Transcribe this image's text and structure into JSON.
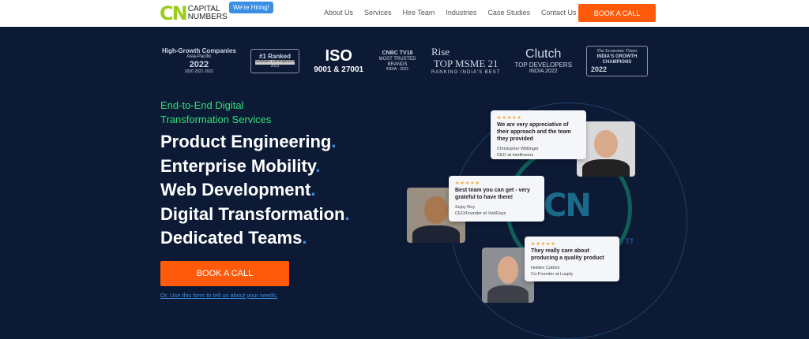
{
  "header": {
    "logo_mark": "CN",
    "logo_line1": "CAPITAL",
    "logo_line2": "NUMBERS",
    "hiring_badge": "We're Hiring!",
    "nav": [
      "About Us",
      "Services",
      "Hire Team",
      "Industries",
      "Case Studies",
      "Contact Us"
    ],
    "book_call": "BOOK A CALL"
  },
  "awards": [
    {
      "l1": "High-Growth Companies",
      "l2": "Asia-Pacific",
      "l3": "2022",
      "l4": "2020 2021 2022"
    },
    {
      "l1": "#1 Ranked",
      "l2": "Software Development",
      "l3": "2022"
    },
    {
      "l1": "ISO",
      "l2": "9001 & 27001"
    },
    {
      "l1": "CNBC TV18",
      "l2": "MOST TRUSTED BRANDS",
      "l3": "INDIA - 2021"
    },
    {
      "l1": "Rise",
      "l2": "TOP MSME 21",
      "l3": "RANKING INDIA'S BEST"
    },
    {
      "l1": "Clutch",
      "l2": "TOP DEVELOPERS",
      "l3": "INDIA 2022"
    },
    {
      "l1": "The Economic Times",
      "l2": "INDIA'S GROWTH CHAMPIONS",
      "l3": "2022"
    }
  ],
  "hero": {
    "subtitle_1": "End-to-End Digital",
    "subtitle_2": "Transformation Services",
    "headlines": [
      "Product Engineering",
      "Enterprise Mobility",
      "Web Development",
      "Digital Transformation",
      "Dedicated Teams"
    ],
    "dot": ".",
    "book_call": "BOOK A CALL",
    "form_link": "Or, Use this form to tell us about your needs."
  },
  "testimonials": [
    {
      "stars": "★★★★★",
      "quote": "We are very appreciative of their approach and the team they provided",
      "name": "Christopher Wittlinger",
      "role": "CEO at Intellineers"
    },
    {
      "stars": "★★★★★",
      "quote": "Best team you can get - very grateful to have them!",
      "name": "Sujoy Roy",
      "role": "CEO/Founder at VisitDays"
    },
    {
      "stars": "★★★★★",
      "quote": "They really care about producing a quality product",
      "name": "Holden Cattoni",
      "role": "Co-Founder at Luuply"
    }
  ],
  "graphic": {
    "mark": "CN",
    "quote_mark": "”"
  }
}
